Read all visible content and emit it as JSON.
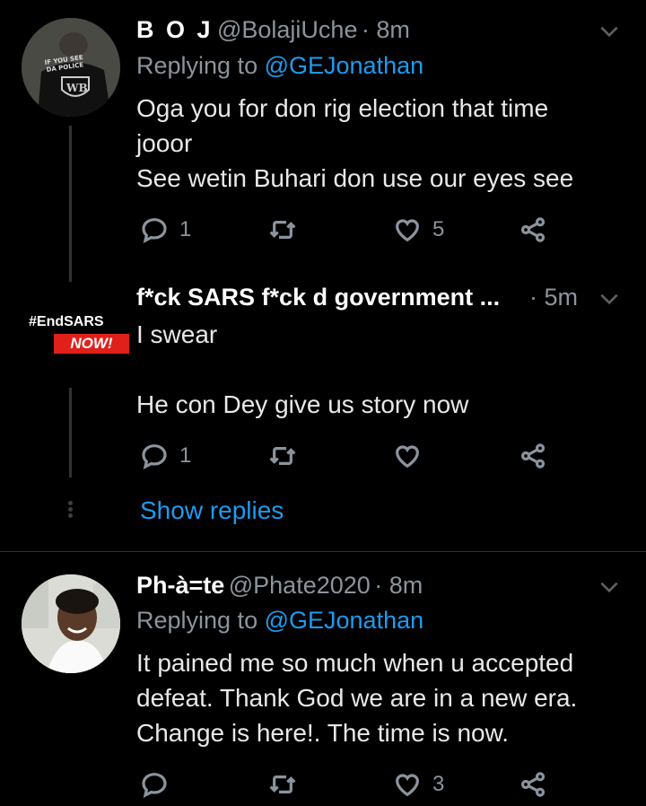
{
  "tweets": [
    {
      "display_name": "B O J",
      "handle": "@BolajiUche",
      "time": "· 8m",
      "replying_label": "Replying to",
      "replying_to": "@GEJonathan",
      "lines": [
        "Oga you for don rig election that time",
        "jooor",
        "See wetin Buhari don use our eyes see"
      ],
      "replies": "1",
      "likes": "5"
    },
    {
      "display_name": "f*ck SARS f*ck d government ...",
      "time": "· 5m",
      "lines": [
        "I swear",
        "",
        "He con Dey give us story now"
      ],
      "replies": "1",
      "likes": "",
      "avatar_badge_top": "#EndSARS",
      "avatar_badge_bottom": "NOW!"
    },
    {
      "display_name": "Ph-à=te",
      "handle": "@Phate2020",
      "time": "· 8m",
      "replying_label": "Replying to",
      "replying_to": "@GEJonathan",
      "lines": [
        "It pained me so much when u accepted",
        "defeat. Thank God we are in a new era.",
        "Change is here!. The time is now."
      ],
      "replies": "",
      "likes": "3"
    }
  ],
  "show_replies": "Show replies",
  "icons": [
    "reply-icon",
    "retweet-icon",
    "like-icon",
    "share-icon",
    "caret-down-icon",
    "more-dots-icon"
  ],
  "colors": {
    "background": "#000000",
    "link": "#1d9bf0",
    "secondary_text": "#8b949c",
    "badge_red": "#e0201b"
  }
}
